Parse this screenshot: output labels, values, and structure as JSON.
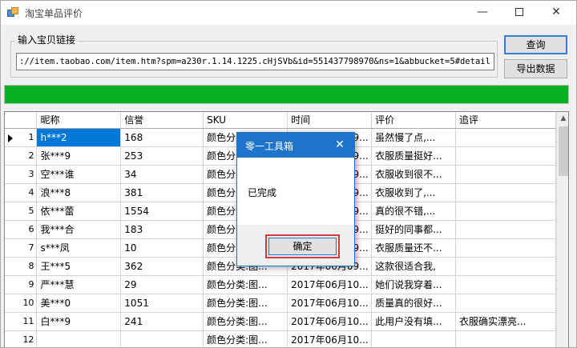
{
  "window": {
    "title": "淘宝单品评价",
    "min_glyph": "—",
    "close_glyph": "✕"
  },
  "input_section": {
    "group_label": "输入宝贝链接",
    "url_value": "://item.taobao.com/item.htm?spm=a230r.1.14.1225.cHjSVb&id=551437798970&ns=1&abbucket=5#detail",
    "query_button": "查询",
    "export_button": "导出数据"
  },
  "progress": {
    "percent": 100,
    "color": "#06b025"
  },
  "grid": {
    "columns": [
      "昵称",
      "信誉",
      "SKU",
      "时间",
      "评价",
      "追评"
    ],
    "rows": [
      {
        "num": "1",
        "nick": "h***2",
        "rep": "168",
        "sku": "颜色分类:图...",
        "time": "2017年06月09...",
        "review": "虽然慢了点,...",
        "followup": ""
      },
      {
        "num": "2",
        "nick": "张***9",
        "rep": "253",
        "sku": "颜色分类:图...",
        "time": "2017年06月09...",
        "review": "衣服质量挺好...",
        "followup": ""
      },
      {
        "num": "3",
        "nick": "空***谁",
        "rep": "34",
        "sku": "颜色分类:图...",
        "time": "2017年06月09...",
        "review": "衣服收到很不...",
        "followup": ""
      },
      {
        "num": "4",
        "nick": "浪***8",
        "rep": "381",
        "sku": "颜色分类:图...",
        "time": "2017年06月09...",
        "review": "衣服收到了,...",
        "followup": ""
      },
      {
        "num": "5",
        "nick": "依***蕾",
        "rep": "1554",
        "sku": "颜色分类:图...",
        "time": "2017年06月09...",
        "review": "真的很不错,...",
        "followup": ""
      },
      {
        "num": "6",
        "nick": "我***合",
        "rep": "183",
        "sku": "颜色分类:图...",
        "time": "2017年06月09...",
        "review": "挺好的同事都...",
        "followup": ""
      },
      {
        "num": "7",
        "nick": "s***凤",
        "rep": "10",
        "sku": "颜色分类:图...",
        "time": "2017年06月09...",
        "review": "衣服质量还不...",
        "followup": ""
      },
      {
        "num": "8",
        "nick": "王***5",
        "rep": "362",
        "sku": "颜色分类:图...",
        "time": "2017年06月09...",
        "review": "这款很适合我,",
        "followup": ""
      },
      {
        "num": "9",
        "nick": "严***慧",
        "rep": "29",
        "sku": "颜色分类:图...",
        "time": "2017年06月10...",
        "review": "她们说我穿着...",
        "followup": ""
      },
      {
        "num": "10",
        "nick": "美***0",
        "rep": "1051",
        "sku": "颜色分类:图...",
        "time": "2017年06月10...",
        "review": "质量真的很好...",
        "followup": ""
      },
      {
        "num": "11",
        "nick": "白***9",
        "rep": "241",
        "sku": "颜色分类:图...",
        "time": "2017年06月10...",
        "review": "此用户没有填...",
        "followup": "衣服确实漂亮..."
      },
      {
        "num": "12",
        "nick": "",
        "rep": "",
        "sku": "颜色分类:图...",
        "time": "2017年06月10...",
        "review": "",
        "followup": ""
      }
    ]
  },
  "dialog": {
    "title": "零一工具箱",
    "message": "已完成",
    "ok_button": "确定",
    "close_glyph": "✕"
  }
}
